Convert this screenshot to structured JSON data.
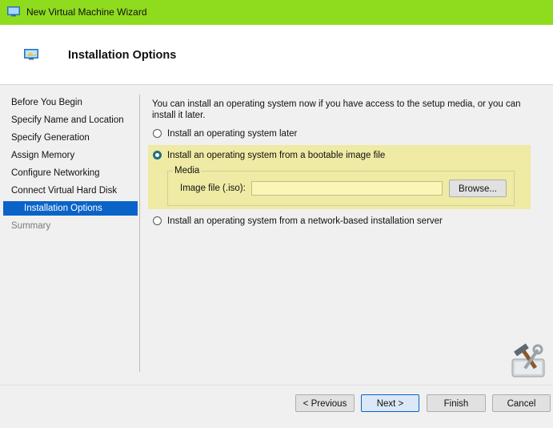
{
  "window": {
    "title": "New Virtual Machine Wizard",
    "app_icon": "monitor-icon"
  },
  "header": {
    "title": "Installation Options",
    "icon": "monitor-icon"
  },
  "sidebar": {
    "items": [
      {
        "label": "Before You Begin",
        "state": "normal"
      },
      {
        "label": "Specify Name and Location",
        "state": "normal"
      },
      {
        "label": "Specify Generation",
        "state": "normal"
      },
      {
        "label": "Assign Memory",
        "state": "normal"
      },
      {
        "label": "Configure Networking",
        "state": "normal"
      },
      {
        "label": "Connect Virtual Hard Disk",
        "state": "normal"
      },
      {
        "label": "Installation Options",
        "state": "current"
      },
      {
        "label": "Summary",
        "state": "disabled"
      }
    ]
  },
  "main": {
    "intro": "You can install an operating system now if you have access to the setup media, or you can install it later.",
    "options": [
      {
        "label": "Install an operating system later",
        "selected": false
      },
      {
        "label": "Install an operating system from a bootable image file",
        "selected": true
      },
      {
        "label": "Install an operating system from a network-based installation server",
        "selected": false
      }
    ],
    "media": {
      "legend": "Media",
      "image_file_label": "Image file (.iso):",
      "image_file_value": "",
      "browse_label": "Browse..."
    }
  },
  "footer": {
    "previous_label": "< Previous",
    "next_label": "Next >",
    "finish_label": "Finish",
    "cancel_label": "Cancel"
  },
  "colors": {
    "titlebar": "#8fdc1f",
    "selection": "#0a64c8",
    "highlight": "#efeaa4"
  }
}
